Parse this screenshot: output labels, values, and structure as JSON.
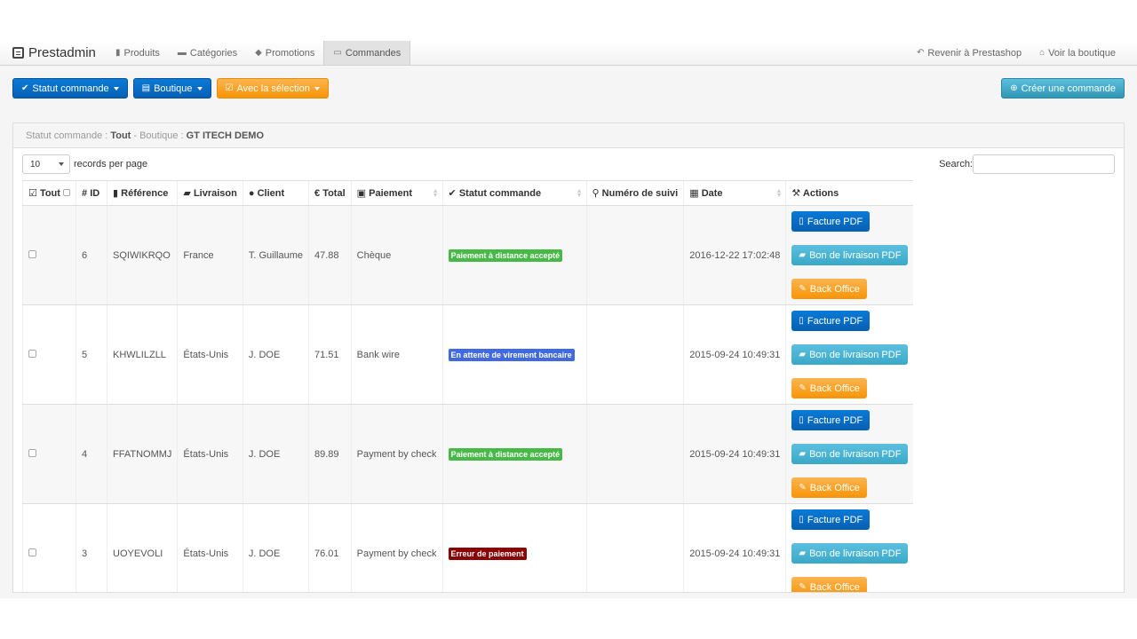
{
  "brand": {
    "name": "Prestadmin",
    "icon": "list-icon"
  },
  "nav": {
    "items": [
      {
        "label": "Produits",
        "icon": "book-icon",
        "glyph": "▮",
        "active": false
      },
      {
        "label": "Catégories",
        "icon": "folder-icon",
        "glyph": "▬",
        "active": false
      },
      {
        "label": "Promotions",
        "icon": "tag-icon",
        "glyph": "◆",
        "active": false
      },
      {
        "label": "Commandes",
        "icon": "card-icon",
        "glyph": "▭",
        "active": true
      }
    ],
    "right": [
      {
        "label": "Revenir à Prestashop",
        "icon": "undo-icon",
        "glyph": "↶"
      },
      {
        "label": "Voir la boutique",
        "icon": "home-icon",
        "glyph": "⌂"
      }
    ]
  },
  "toolbar": {
    "statut_label": "Statut commande",
    "boutique_label": "Boutique",
    "selection_label": "Avec la sélection",
    "create_label": "Créer une commande"
  },
  "filter": {
    "prefix": "Statut commande :",
    "status": "Tout",
    "mid": "- Boutique :",
    "shop": "GT ITECH DEMO"
  },
  "controls": {
    "page_size": "10",
    "per_page_label": "records per page",
    "search_label": "Search:"
  },
  "columns": {
    "all": "Tout",
    "id": "ID",
    "ref": "Référence",
    "ship": "Livraison",
    "client": "Client",
    "total": "Total",
    "pay": "Paiement",
    "status": "Statut commande",
    "track": "Numéro de suivi",
    "date": "Date",
    "actions": "Actions"
  },
  "actions": {
    "invoice": "Facture PDF",
    "delivery": "Bon de livraison PDF",
    "backoffice": "Back Office"
  },
  "colors": {
    "accepted": "#46b946",
    "waiting": "#4169e1",
    "error": "#8b0000",
    "primary": "#0660b4",
    "info": "#5bc0de",
    "warning": "#f89406"
  },
  "orders": [
    {
      "id": "6",
      "ref": "SQIWIKRQO",
      "ship": "France",
      "client": "T. Guillaume",
      "total": "47.88",
      "pay": "Chèque",
      "status": "Paiement à distance accepté",
      "status_color": "#46b946",
      "track": "",
      "date": "2016-12-22 17:02:48"
    },
    {
      "id": "5",
      "ref": "KHWLILZLL",
      "ship": "États-Unis",
      "client": "J. DOE",
      "total": "71.51",
      "pay": "Bank wire",
      "status": "En attente de virement bancaire",
      "status_color": "#4169e1",
      "track": "",
      "date": "2015-09-24 10:49:31"
    },
    {
      "id": "4",
      "ref": "FFATNOMMJ",
      "ship": "États-Unis",
      "client": "J. DOE",
      "total": "89.89",
      "pay": "Payment by check",
      "status": "Paiement à distance accepté",
      "status_color": "#46b946",
      "track": "",
      "date": "2015-09-24 10:49:31"
    },
    {
      "id": "3",
      "ref": "UOYEVOLI",
      "ship": "États-Unis",
      "client": "J. DOE",
      "total": "76.01",
      "pay": "Payment by check",
      "status": "Erreur de paiement",
      "status_color": "#8b0000",
      "track": "",
      "date": "2015-09-24 10:49:31"
    }
  ]
}
